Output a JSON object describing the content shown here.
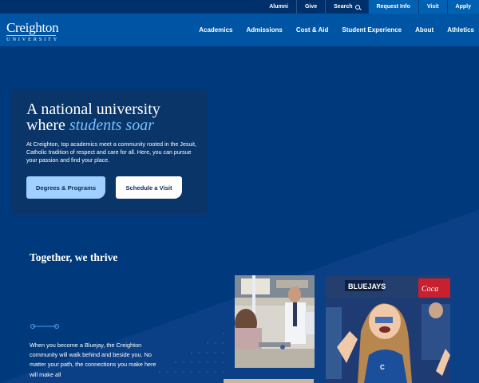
{
  "utility_nav": {
    "links": [
      "Alumni",
      "Give",
      "Search"
    ],
    "ctas": [
      "Request Info",
      "Visit",
      "Apply"
    ]
  },
  "logo": {
    "main": "Creighton",
    "sub": "UNIVERSITY"
  },
  "main_nav": [
    "Academics",
    "Admissions",
    "Cost & Aid",
    "Student Experience",
    "About",
    "Athletics"
  ],
  "hero": {
    "title_line1": "A national university",
    "title_line2_prefix": "where ",
    "title_line2_emphasis": "students soar",
    "copy": "At Creighton, top academics meet a community rooted in the Jesuit, Catholic tradition of respect and care for all. Here, you can pursue your passion and find your place.",
    "primary_button": "Degrees & Programs",
    "secondary_button": "Schedule a Visit"
  },
  "together": {
    "title": "Together, we thrive",
    "copy": "When you become a Bluejay, the Creighton community will walk behind and beside you. No matter your path, the connections you make here will make all"
  },
  "photos": {
    "fan_sign": "BLUEJAYS",
    "fan_banner": "Coca"
  },
  "colors": {
    "utility_bar": "#00306b",
    "nav_bar": "#0054a4",
    "hero_bg": "#003a7d",
    "accent_light_blue": "#9fd0ff",
    "emphasis_text": "#74c0ff"
  }
}
